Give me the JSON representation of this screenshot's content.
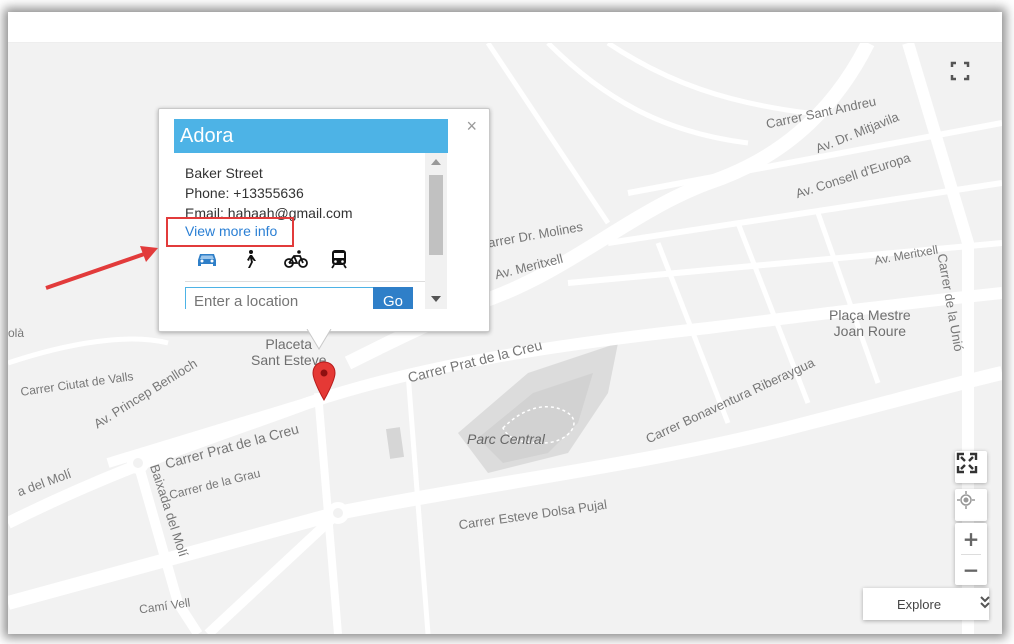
{
  "map": {
    "labels": {
      "sant_andreu": "Carrer Sant Andreu",
      "mitjavila": "Av. Dr. Mitjavila",
      "consell": "Av. Consell d'Europa",
      "molines": "Carrer Dr. Molines",
      "meritxell_left": "Av. Meritxell",
      "meritxell_right": "Av. Meritxell",
      "carrer_unio": "Carrer de la Unió",
      "placa_mestre": "Plaça Mestre\nJoan Roure",
      "placeta": "Placeta\nSant Esteve",
      "prat_creu_top": "Carrer Prat de la Creu",
      "prat_creu_bottom": "Carrer Prat de la Creu",
      "bonaventura": "Carrer Bonaventura Riberaygua",
      "parc_central": "Parc Central",
      "ciutat_valls": "Carrer Ciutat de Valls",
      "princep": "Av. Princep Benlloch",
      "del_moli": "a del Molí",
      "baixada": "Baixada del Molí",
      "grau": "Carrer de la Grau",
      "esteve_dolsa": "Carrer Esteve Dolsa Pujal",
      "cami_vell": "Camí Vell",
      "ola": "olà"
    },
    "marker_color": "#e53935"
  },
  "popup": {
    "title": "Adora",
    "close_symbol": "×",
    "address": "Baker Street",
    "phone": "Phone: +13355636",
    "email": "Email: hahaah@gmail.com",
    "more_link": "View more info",
    "travel_modes": [
      "car-icon",
      "walk-icon",
      "bike-icon",
      "transit-icon"
    ],
    "location_placeholder": "Enter a location",
    "go_label": "Go",
    "title_color": "#4db3e6"
  },
  "controls": {
    "zoom_in": "+",
    "zoom_out": "−",
    "explore_label": "Explore",
    "explore_icon": "»"
  },
  "annotation": {
    "highlight_color": "#e23b3b"
  }
}
